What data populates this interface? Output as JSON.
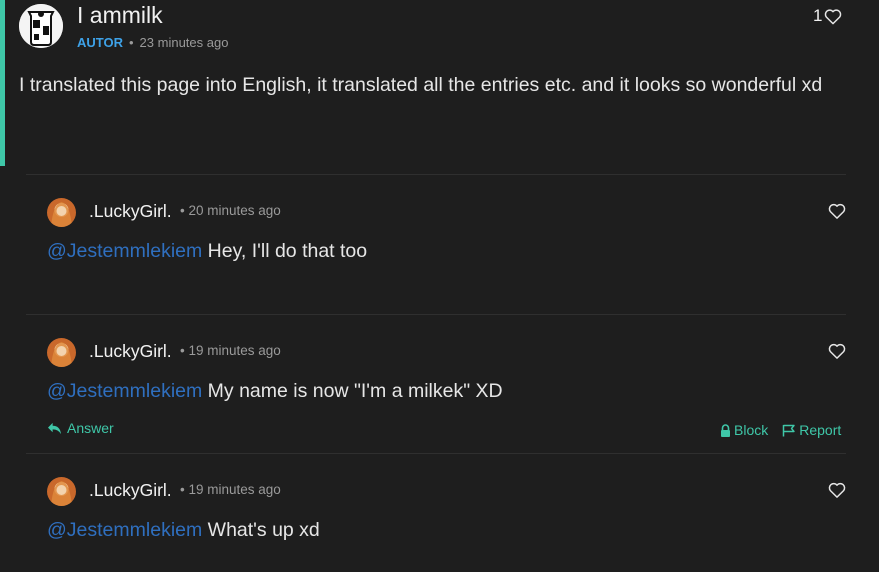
{
  "main_comment": {
    "author": "I ammilk",
    "badge": "AUTOR",
    "time": "23 minutes ago",
    "likes": "1",
    "text": "I translated this page into English, it translated all the entries etc. and it looks so wonderful xd"
  },
  "replies": [
    {
      "author": ".LuckyGirl.",
      "time": "20 minutes ago",
      "mention": "@Jestemmlekiem",
      "text": " Hey, I'll do that too"
    },
    {
      "author": ".LuckyGirl.",
      "time": "19 minutes ago",
      "mention": "@Jestemmlekiem",
      "text": " My name is now \"I'm a milkek\" XD",
      "answer_label": "Answer",
      "block_label": "Block",
      "report_label": "Report"
    },
    {
      "author": ".LuckyGirl.",
      "time": "19 minutes ago",
      "mention": "@Jestemmlekiem",
      "text": " What's up xd"
    }
  ],
  "icons": {
    "like": "heart-outline-icon",
    "answer": "reply-arrow-icon",
    "block": "lock-icon",
    "report": "flag-icon"
  },
  "colors": {
    "background": "#1e1e1e",
    "accent": "#3fc7a8",
    "author_badge": "#3ea2e8",
    "mention": "#2f6fbf",
    "muted": "#9a9a9a"
  }
}
